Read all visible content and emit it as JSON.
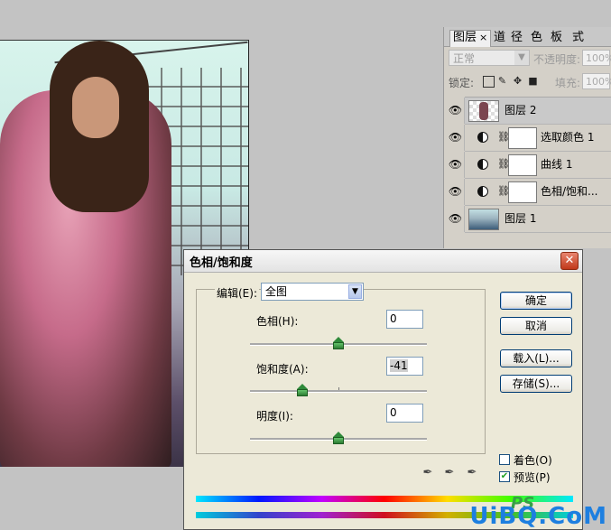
{
  "layers_panel": {
    "tabs": [
      {
        "label": "图层",
        "close": "×"
      },
      {
        "label": "道"
      },
      {
        "label": "径"
      },
      {
        "label": "色"
      },
      {
        "label": "板"
      },
      {
        "label": "式"
      }
    ],
    "blend_mode": "正常",
    "opacity_label": "不透明度:",
    "opacity_value": "100%",
    "lock_label": "锁定:",
    "fill_label": "填充:",
    "fill_value": "100%",
    "layers": [
      {
        "name": "图层 2",
        "selected": true
      },
      {
        "name": "选取颜色 1"
      },
      {
        "name": "曲线 1"
      },
      {
        "name": "色相/饱和..."
      },
      {
        "name": "图层 1"
      }
    ]
  },
  "dialog": {
    "title": "色相/饱和度",
    "close": "✕",
    "edit_label": "编辑(E):",
    "edit_value": "全图",
    "hue_label": "色相(H):",
    "hue_value": "0",
    "hue_level": 0,
    "saturation_label": "饱和度(A):",
    "saturation_value": "-41",
    "saturation_level": -41,
    "lightness_label": "明度(I):",
    "lightness_value": "0",
    "lightness_level": 0,
    "ok_label": "确定",
    "cancel_label": "取消",
    "load_label": "载入(L)...",
    "save_label": "存储(S)...",
    "colorize_label": "着色(O)",
    "colorize_checked": false,
    "preview_label": "预览(P)",
    "preview_checked": true
  },
  "watermark": {
    "brand_top": "PS",
    "brand_text": "UiBQ.CoM"
  },
  "colors": {
    "close_red": "#c0391b",
    "thumb_green": "#2f8a3a",
    "check_green": "#21a121"
  }
}
